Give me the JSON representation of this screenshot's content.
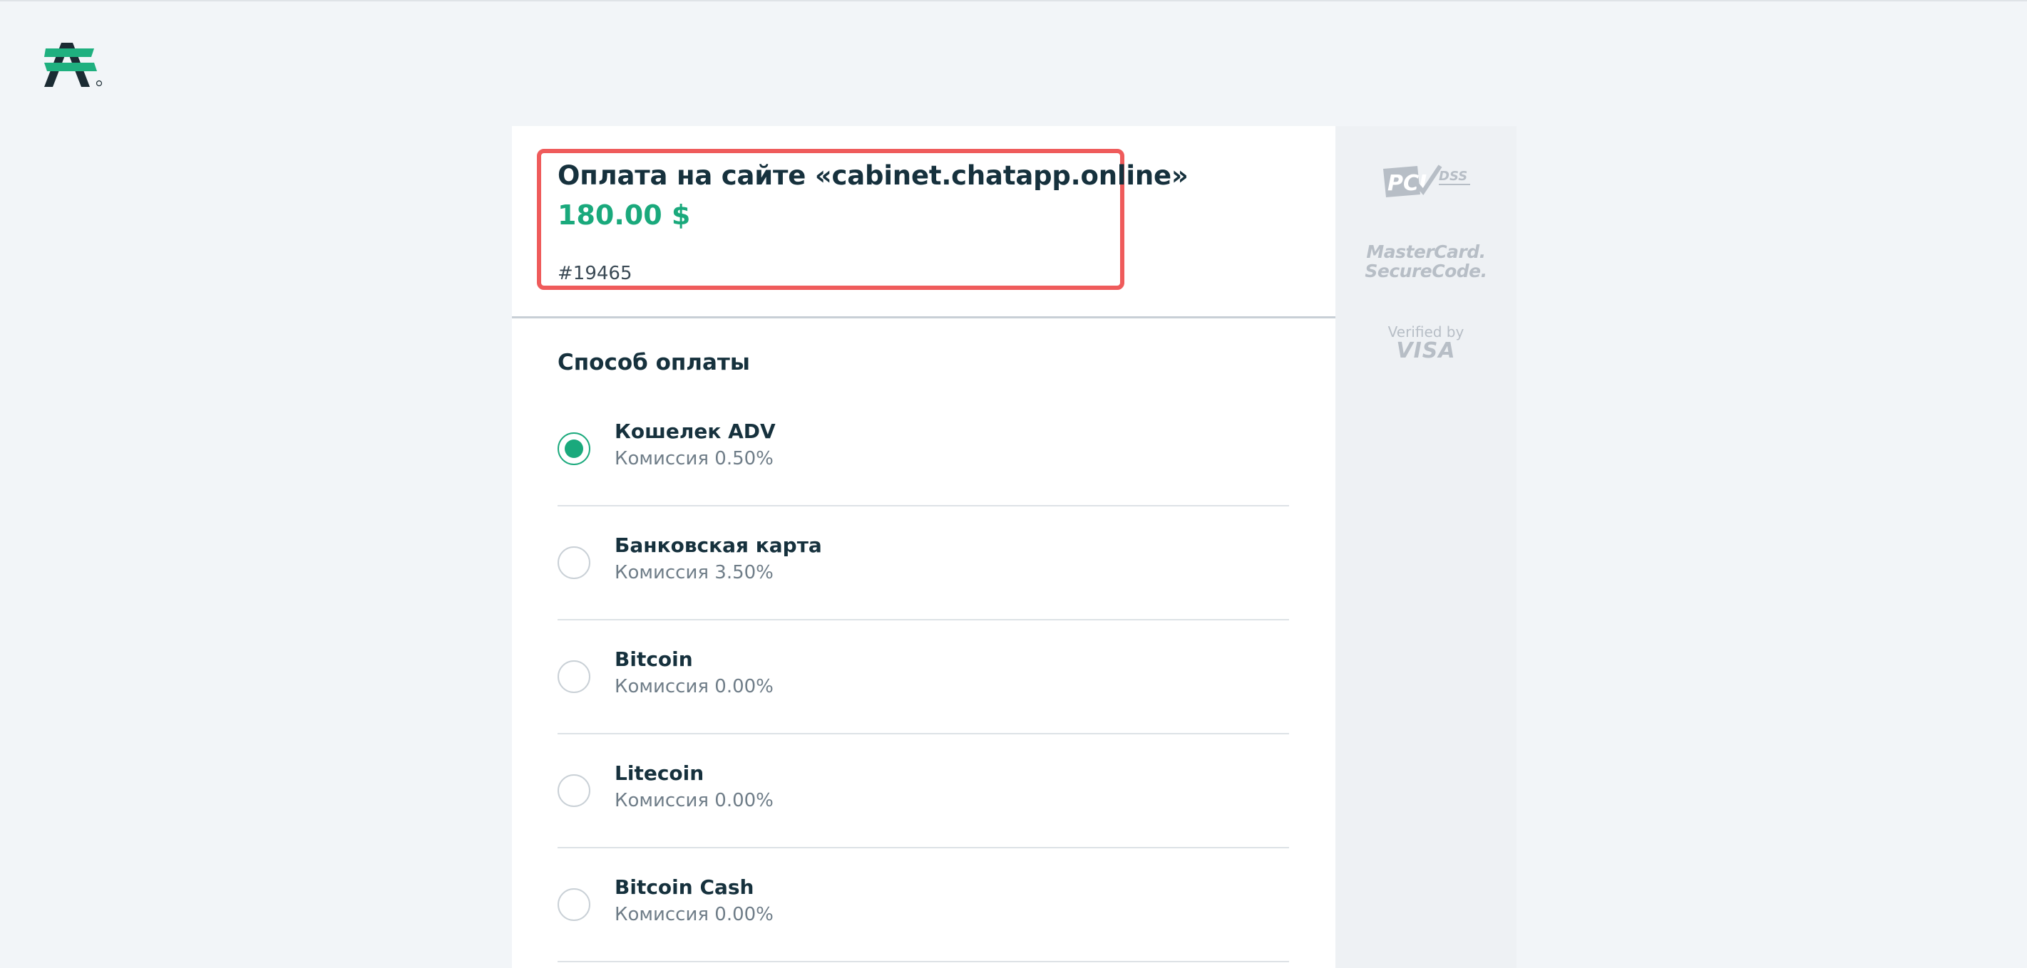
{
  "payment": {
    "title": "Оплата на сайте «cabinet.chatapp.online»",
    "amount": "180.00 $",
    "order_id": "#19465"
  },
  "methods_section": {
    "title": "Способ оплаты",
    "selected_index": 0,
    "items": [
      {
        "name": "Кошелек ADV",
        "fee": "Комиссия 0.50%",
        "selected": true
      },
      {
        "name": "Банковская карта",
        "fee": "Комиссия 3.50%",
        "selected": false
      },
      {
        "name": "Bitcoin",
        "fee": "Комиссия 0.00%",
        "selected": false
      },
      {
        "name": "Litecoin",
        "fee": "Комиссия 0.00%",
        "selected": false
      },
      {
        "name": "Bitcoin Cash",
        "fee": "Комиссия 0.00%",
        "selected": false
      }
    ]
  },
  "security_badges": {
    "pci": {
      "logo_text": "PCI",
      "suffix": "DSS"
    },
    "mastercard": {
      "line1": "MasterCard.",
      "line2": "SecureCode."
    },
    "visa": {
      "line1": "Verified by",
      "line2": "VISA"
    }
  },
  "colors": {
    "accent": "#1aa97c",
    "highlight_border": "#ef5b5b",
    "text_primary": "#16313d",
    "text_secondary": "#6f7d88",
    "page_bg": "#f2f5f8"
  }
}
